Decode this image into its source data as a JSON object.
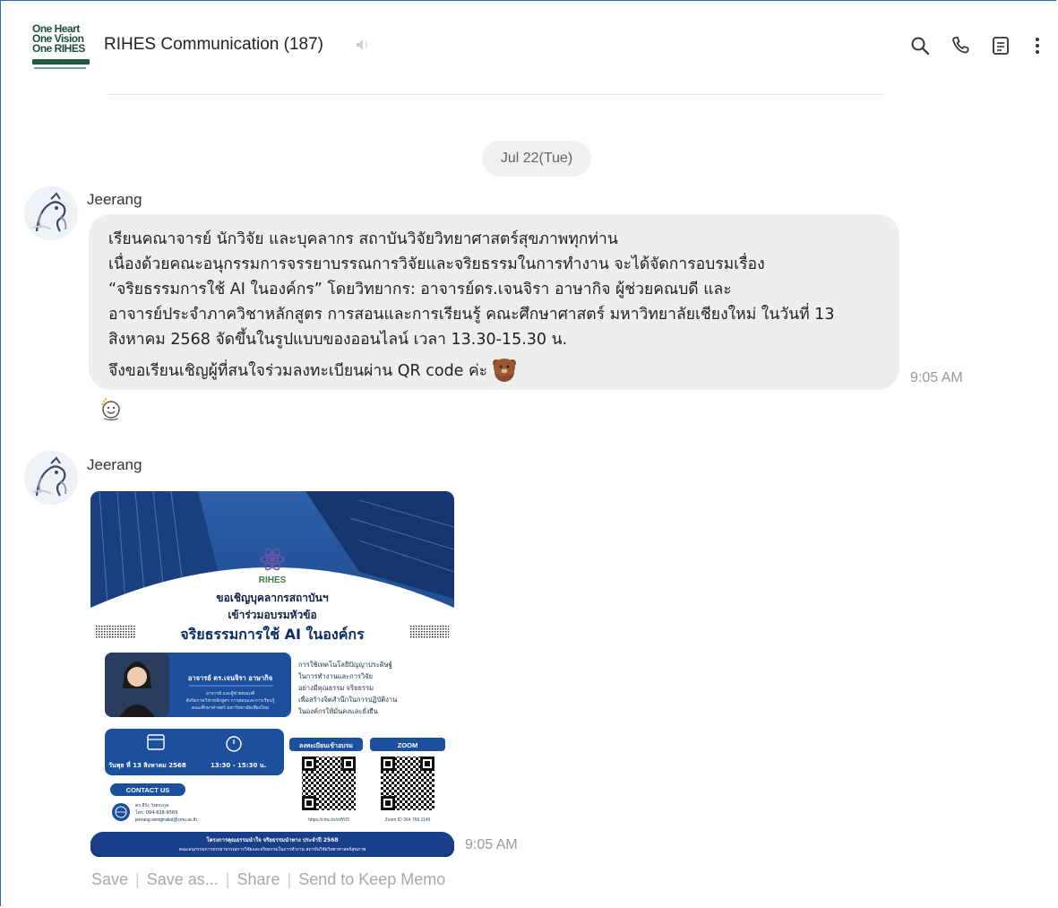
{
  "header": {
    "logo_lines": [
      "One Heart",
      "One Vision",
      "One RIHES"
    ],
    "title": "RIHES Communication (187)",
    "icons": [
      "mute-speaker-icon",
      "search-icon",
      "phone-icon",
      "notes-icon",
      "more-vertical-icon"
    ]
  },
  "date_separator": "Jul 22(Tue)",
  "messages": [
    {
      "sender": "Jeerang",
      "lines": [
        "เรียนคณาจารย์ นักวิจัย และบุคลากร สถาบันวิจัยวิทยาศาสตร์สุขภาพทุกท่าน",
        "เนื่องด้วยคณะอนุกรรมการจรรยาบรรณการวิจัยและจริยธรรมในการทำงาน จะได้จัดการอบรมเรื่อง",
        "“จริยธรรมการใช้ AI ในองค์กร” โดยวิทยากร: อาจารย์ดร.เจนจิรา อาษากิจ ผู้ช่วยคณบดี และ",
        "อาจารย์ประจำภาควิชาหลักสูตร การสอนและการเรียนรู้ คณะศึกษาศาสตร์ มหาวิทยาลัยเชียงใหม่ ในวันที่ 13",
        "สิงหาคม 2568 จัดขึ้นในรูปแบบของออนไลน์ เวลา 13.30-15.30 น.",
        "จึงขอเรียนเชิญผู้ที่สนใจร่วมลงทะเบียนผ่าน QR code ค่ะ"
      ],
      "time": "9:05 AM"
    },
    {
      "sender": "Jeerang",
      "time": "9:05 AM"
    }
  ],
  "poster": {
    "org": "RIHES",
    "invite_line1": "ขอเชิญบุคลากรสถาบันฯ",
    "invite_line2": "เข้าร่วมอบรมหัวข้อ",
    "topic": "จริยธรรมการใช้ AI ในองค์กร",
    "speaker_name": "อาจารย์ ดร.เจนจิรา อาษากิจ",
    "speaker_role1": "อาจารย์ และผู้ช่วยคณบดี",
    "speaker_role2": "สังกัดภาควิชาหลักสูตร การสอนและการเรียนรู้",
    "speaker_role3": "คณะศึกษาศาสตร์ มหาวิทยาลัยเชียงใหม่",
    "desc1": "การใช้เทคโนโลยีปัญญาประดิษฐ์",
    "desc2": "ในการทำงานและการวิจัย",
    "desc3": "อย่างมีคุณธรรม จริยธรรม",
    "desc4": "เพื่อสร้างจิตสำนึกในการปฏิบัติงาน",
    "desc5": "ในองค์กรให้มั่นคงและยั่งยืน",
    "date_text": "วันพุธ ที่ 13 สิงหาคม 2568",
    "time_text": "13:30 - 15:30 น.",
    "register_label": "ลงทะเบียนเข้าอบรม",
    "zoom_label": "ZOOM",
    "register_link": "https://cmu.to/cdY03",
    "zoom_id": "Zoom ID 364 766 1149",
    "contact_label": "CONTACT US",
    "contact_name": "ดร.จีรัง วังตระกูล",
    "contact_phone": "โทร. 094-628-9569",
    "contact_email": "jeerang.wongtrakul@cmu.ac.th",
    "footer1": "โครงการคุณธรรมนำใจ จริยธรรมนำทาง ประจำปี 2568",
    "footer2": "คณะอนุกรรมการจรรยาบรรณการวิจัยและจริยธรรมในการทำงาน สถาบันวิจัยวิทยาศาสตร์สุขภาพ"
  },
  "image_actions": [
    "Save",
    "Save as...",
    "Share",
    "Send to Keep Memo"
  ]
}
